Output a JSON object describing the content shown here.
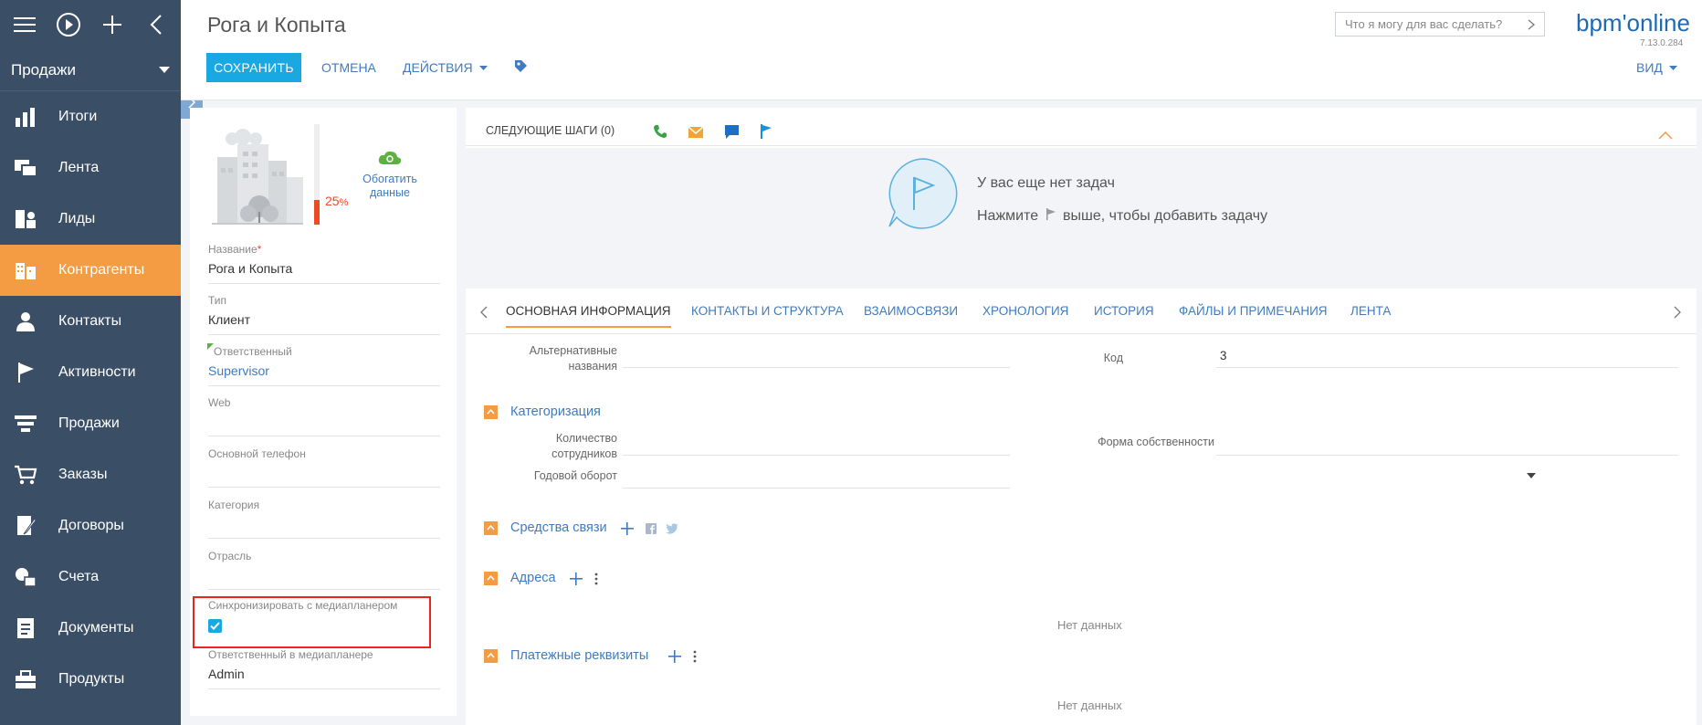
{
  "sidebar": {
    "section": "Продажи",
    "items": [
      {
        "label": "Итоги",
        "icon": "bar-chart-icon"
      },
      {
        "label": "Лента",
        "icon": "feed-icon"
      },
      {
        "label": "Лиды",
        "icon": "leads-icon"
      },
      {
        "label": "Контрагенты",
        "icon": "accounts-icon",
        "active": true
      },
      {
        "label": "Контакты",
        "icon": "contact-person-icon"
      },
      {
        "label": "Активности",
        "icon": "flag-icon"
      },
      {
        "label": "Продажи",
        "icon": "funnel-icon"
      },
      {
        "label": "Заказы",
        "icon": "cart-icon"
      },
      {
        "label": "Договоры",
        "icon": "contract-icon"
      },
      {
        "label": "Счета",
        "icon": "invoice-icon"
      },
      {
        "label": "Документы",
        "icon": "document-icon"
      },
      {
        "label": "Продукты",
        "icon": "products-icon"
      }
    ]
  },
  "header": {
    "title": "Рога и Копыта",
    "save": "СОХРАНИТЬ",
    "cancel": "ОТМЕНА",
    "actions": "ДЕЙСТВИЯ",
    "ask_placeholder": "Что я могу для вас сделать?",
    "brand": "bpm'online",
    "version": "7.13.0.284",
    "view": "ВИД"
  },
  "profile": {
    "completeness": "25",
    "completeness_unit": "%",
    "enrich_label": "Обогатить данные",
    "fields": [
      {
        "label": "Название",
        "value": "Рога и Копыта",
        "required": "*"
      },
      {
        "label": "Тип",
        "value": "Клиент"
      },
      {
        "label": "Ответственный",
        "value": "Supervisor"
      },
      {
        "label": "Web",
        "value": ""
      },
      {
        "label": "Основной телефон",
        "value": ""
      },
      {
        "label": "Категория",
        "value": ""
      },
      {
        "label": "Отрасль",
        "value": ""
      },
      {
        "label": "Синхронизировать с медиапланером",
        "checked": true
      },
      {
        "label": "Ответственный в медиапланере",
        "value": "Admin"
      }
    ]
  },
  "next_steps": {
    "title": "СЛЕДУЮЩИЕ ШАГИ (0)",
    "empty_title": "У вас еще нет задач",
    "empty_hint_a": "Нажмите",
    "empty_hint_b": "выше, чтобы добавить задачу"
  },
  "tabs": [
    "ОСНОВНАЯ ИНФОРМАЦИЯ",
    "КОНТАКТЫ И СТРУКТУРА",
    "ВЗАИМОСВЯЗИ",
    "ХРОНОЛОГИЯ",
    "ИСТОРИЯ",
    "ФАЙЛЫ И ПРИМЕЧАНИЯ",
    "ЛЕНТА"
  ],
  "detail": {
    "alt_names_1": "Альтернативные",
    "alt_names_2": "названия",
    "code_label": "Код",
    "code_value": "3",
    "categorization": "Категоризация",
    "employees_1": "Количество",
    "employees_2": "сотрудников",
    "ownership": "Форма собственности",
    "revenue": "Годовой оборот",
    "communication": "Средства связи",
    "addresses": "Адреса",
    "payment": "Платежные реквизиты",
    "no_data": "Нет данных"
  },
  "colors": {
    "accent": "#f39c43",
    "primary": "#1aa8e3",
    "link": "#3e7bc0",
    "sidebar": "#3a4e66"
  }
}
